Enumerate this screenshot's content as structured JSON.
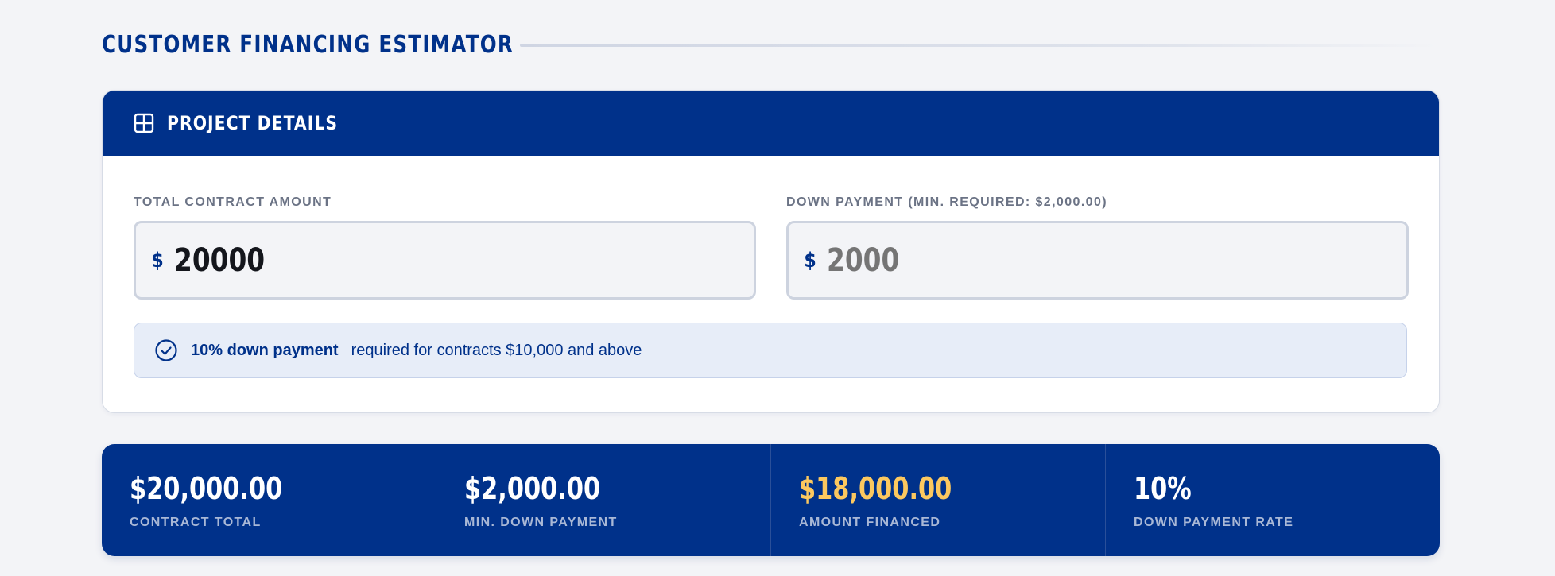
{
  "page": {
    "title": "CUSTOMER FINANCING ESTIMATOR"
  },
  "project_card": {
    "title": "PROJECT DETAILS",
    "icon": "grid-icon",
    "contract_field": {
      "label": "TOTAL CONTRACT AMOUNT",
      "currency_symbol": "$",
      "value": "20000"
    },
    "down_payment_field": {
      "label": "DOWN PAYMENT (MIN. REQUIRED: $2,000.00)",
      "currency_symbol": "$",
      "value": "",
      "placeholder": "2000"
    },
    "note": {
      "icon": "check-circle-icon",
      "strong_text": "10% down payment",
      "text": "required for contracts $10,000 and above"
    }
  },
  "summary": {
    "stats": [
      {
        "value": "$20,000.00",
        "label": "CONTRACT TOTAL"
      },
      {
        "value": "$2,000.00",
        "label": "MIN. DOWN PAYMENT"
      },
      {
        "value": "$18,000.00",
        "label": "AMOUNT FINANCED"
      },
      {
        "value": "10%",
        "label": "DOWN PAYMENT RATE"
      }
    ]
  },
  "colors": {
    "brand_navy": "#00318a",
    "accent_gold": "#fcc85f",
    "page_background": "#f3f4f7"
  }
}
